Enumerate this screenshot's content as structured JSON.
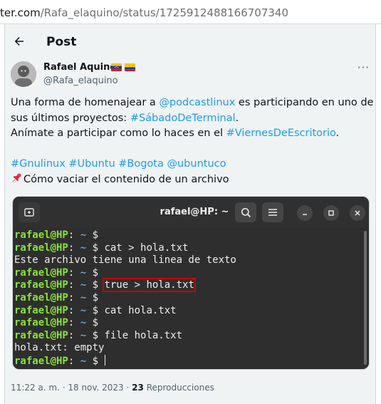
{
  "browser": {
    "url_domain": "ter.com",
    "url_path": "/Rafa_elaquino/status/1725912488166707340"
  },
  "header": {
    "title": "Post",
    "back_icon": "arrow-left-icon"
  },
  "author": {
    "display_name": "Rafael Aquino",
    "handle": "@Rafa_elaquino",
    "flags": [
      "venezuela-flag-icon",
      "colombia-flag-icon"
    ],
    "more_icon": "more-horizontal-icon",
    "more_label": "···"
  },
  "tweet": {
    "line1_pre": "Una forma de homenajear a ",
    "line1_mention": "@podcastlinux",
    "line1_post": " es participando en uno de",
    "line2_pre": "sus últimos proyectos: ",
    "line2_hashtag": "#SábadoDeTerminal",
    "line2_post": ".",
    "line3_pre": "Anímate a participar como lo haces en el ",
    "line3_hashtag": "#ViernesDeEscritorio",
    "line3_post": ".",
    "tag1": "#Gnulinux",
    "tag2": "#Ubuntu",
    "tag3": "#Bogota",
    "tag4": "@ubuntuco",
    "line5": "Cómo vaciar el contenido de un archivo",
    "pin_icon": "pushpin-icon"
  },
  "terminal": {
    "title": "rafael@HP: ~",
    "prompt_user": "rafael@HP",
    "prompt_colon": ":",
    "prompt_path": " ~",
    "prompt_dollar": " $ ",
    "lines": [
      {
        "kind": "prompt",
        "cmd": ""
      },
      {
        "kind": "prompt",
        "cmd": "cat > hola.txt"
      },
      {
        "kind": "output",
        "text": "Este archivo tiene una linea de texto"
      },
      {
        "kind": "prompt",
        "cmd": ""
      },
      {
        "kind": "prompt",
        "cmd": "true > hola.txt",
        "highlight": true
      },
      {
        "kind": "prompt",
        "cmd": ""
      },
      {
        "kind": "prompt",
        "cmd": "cat hola.txt"
      },
      {
        "kind": "prompt",
        "cmd": ""
      },
      {
        "kind": "prompt",
        "cmd": "file hola.txt"
      },
      {
        "kind": "output",
        "text": "hola.txt: empty"
      },
      {
        "kind": "prompt",
        "cmd": "",
        "cursor": true
      }
    ]
  },
  "meta": {
    "time": "11:22 a. m. · 18 nov. 2023",
    "separator": " · ",
    "views_count": "23",
    "views_label": "Reproducciones"
  },
  "colors": {
    "link": "#1d9bf0",
    "prompt_user": "#8ae234",
    "prompt_path": "#729fcf",
    "highlight_box": "#cc0000",
    "terminal_bg": "#2e2e2e"
  }
}
